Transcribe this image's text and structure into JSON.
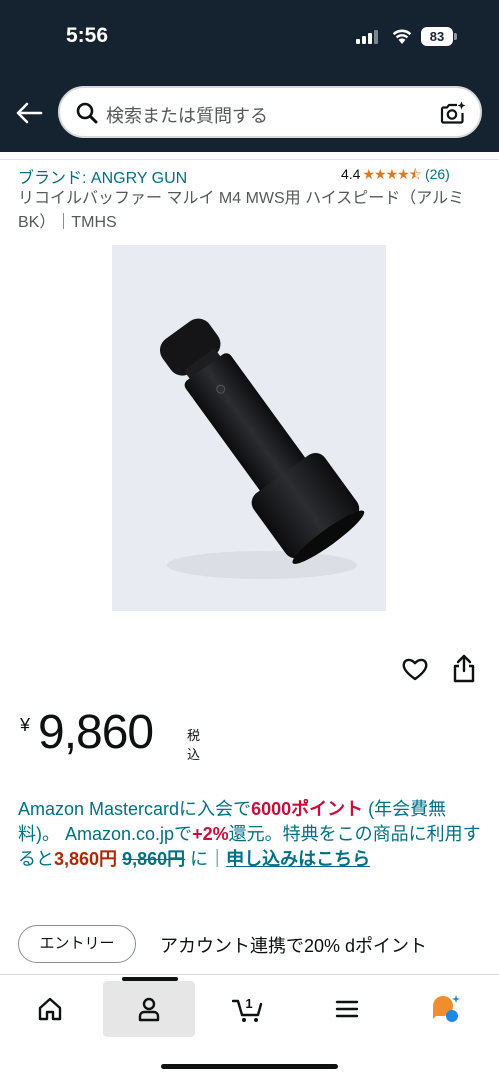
{
  "status_bar": {
    "time": "5:56",
    "battery": "83"
  },
  "search": {
    "placeholder": "検索または質問する"
  },
  "product": {
    "brand": "ブランド: ANGRY GUN",
    "rating_value": "4.4",
    "rating_stars": 4.4,
    "rating_count": "(26)",
    "title": "リコイルバッファー マルイ M4 MWS用 ハイスピード（アルミ BK）｜TMHS"
  },
  "price": {
    "currency_symbol": "¥",
    "amount": "9,860",
    "tax_label": "税込"
  },
  "promo": {
    "part1": "Amazon Mastercardに入会で",
    "points": "6000ポイント",
    "part2": " (年会費無料)。 Amazon.co.jpで",
    "plus": "+2%",
    "part3": "還元。特典をこの商品に利用すると",
    "discounted_price": "3,860円",
    "original_price": "9,860円",
    "part4": " に｜",
    "link": "申し込みはこちら"
  },
  "entry": {
    "button_label": "エントリー",
    "text": "アカウント連携で20% dポイント"
  },
  "nav": {
    "items": [
      "home",
      "account",
      "cart",
      "menu",
      "rufus"
    ],
    "cart_count": "1",
    "active": "account"
  },
  "colors": {
    "header_bg": "#152331",
    "link": "#007185",
    "star": "#de7921",
    "points_red": "#cc0c39",
    "price_orange": "#b12704",
    "rufus_orange": "#f08d2e",
    "rufus_blue": "#1e88e5"
  },
  "icons": [
    "arrow-left-icon",
    "search-icon",
    "camera-search-icon",
    "heart-icon",
    "share-icon",
    "home-icon",
    "person-icon",
    "cart-icon",
    "hamburger-menu-icon",
    "rufus-chat-icon"
  ]
}
